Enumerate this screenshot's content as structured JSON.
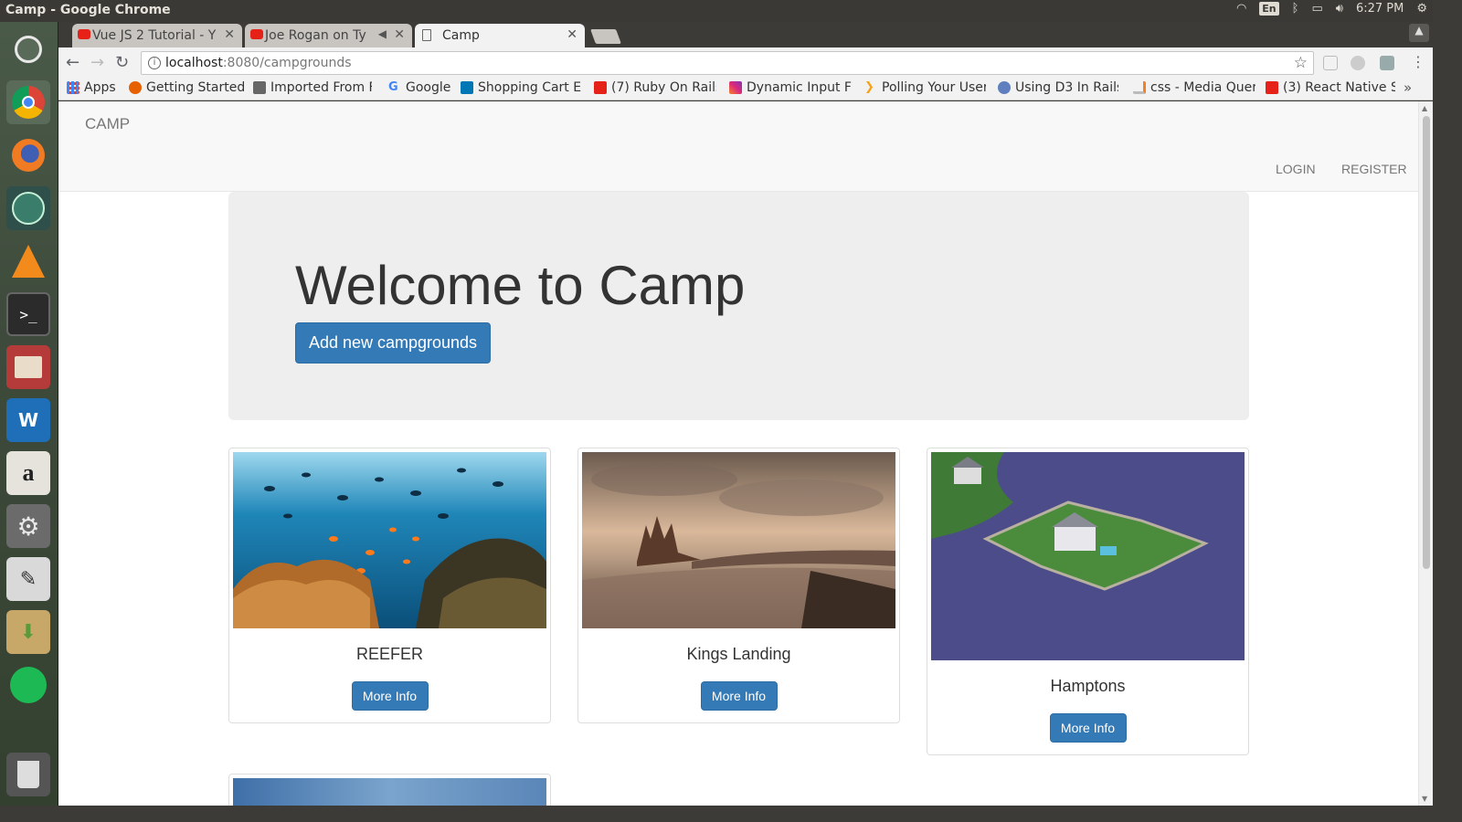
{
  "window": {
    "title": "Camp - Google Chrome"
  },
  "panel": {
    "keyboard": "En",
    "time": "6:27 PM"
  },
  "tabs": [
    {
      "label": "Vue JS 2 Tutorial - Y",
      "icon": "youtube-icon"
    },
    {
      "label": "Joe Rogan on Ty",
      "icon": "youtube-icon"
    },
    {
      "label": "Camp",
      "icon": "document-icon"
    }
  ],
  "address": {
    "host": "localhost",
    "path": ":8080/campgrounds"
  },
  "bookmarks": [
    {
      "label": "Apps",
      "icon": "apps-grid-icon"
    },
    {
      "label": "Getting Started",
      "icon": "firefox-icon"
    },
    {
      "label": "Imported From F",
      "icon": "folder-icon"
    },
    {
      "label": "Google",
      "icon": "google-icon"
    },
    {
      "label": "Shopping Cart Ex",
      "icon": "linkedin-icon"
    },
    {
      "label": "(7) Ruby On Rails",
      "icon": "youtube-icon"
    },
    {
      "label": "Dynamic Input Fi",
      "icon": "instagram-icon"
    },
    {
      "label": "Polling Your User",
      "icon": "codepen-icon"
    },
    {
      "label": "Using D3 In Rails",
      "icon": "d3-icon"
    },
    {
      "label": "css - Media Quer",
      "icon": "stackoverflow-icon"
    },
    {
      "label": "(3) React Native S",
      "icon": "youtube-icon"
    }
  ],
  "site": {
    "brand": "CAMP",
    "nav": {
      "login": "LOGIN",
      "register": "REGISTER"
    },
    "hero": {
      "heading": "Welcome to Camp",
      "button": "Add new campgrounds"
    },
    "campgrounds": [
      {
        "name": "REEFER",
        "button": "More Info"
      },
      {
        "name": "Kings Landing",
        "button": "More Info"
      },
      {
        "name": "Hamptons",
        "button": "More Info"
      }
    ]
  },
  "colors": {
    "primary": "#337ab7",
    "navbar": "#f8f8f8",
    "jumbotron": "#eeeeee"
  }
}
